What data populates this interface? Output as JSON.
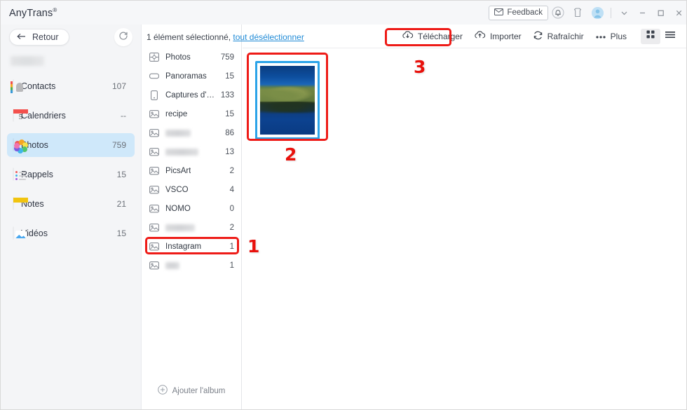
{
  "titlebar": {
    "app_name": "AnyTrans",
    "trademark": "®",
    "feedback_label": "Feedback",
    "icons": [
      "bell-icon",
      "gift-shirt-icon",
      "avatar-icon"
    ],
    "window_controls": [
      "chevron-down-icon",
      "minimize-icon",
      "maximize-icon",
      "close-icon"
    ]
  },
  "sidebar": {
    "back_label": "Retour",
    "sync_icon": "sync-icon",
    "device_name_redacted": "",
    "items": [
      {
        "label": "Contacts",
        "count": "107",
        "icon": "contacts-icon",
        "active": false
      },
      {
        "label": "Calendriers",
        "count": "--",
        "icon": "calendar-icon",
        "active": false
      },
      {
        "label": "Photos",
        "count": "759",
        "icon": "photos-icon",
        "active": true
      },
      {
        "label": "Rappels",
        "count": "15",
        "icon": "reminders-icon",
        "active": false
      },
      {
        "label": "Notes",
        "count": "21",
        "icon": "notes-icon",
        "active": false
      },
      {
        "label": "Vidéos",
        "count": "15",
        "icon": "videos-icon",
        "active": false
      }
    ]
  },
  "albums": {
    "items": [
      {
        "label": "Photos",
        "count": "759",
        "icon": "photos-grid-icon",
        "redacted": false,
        "selected": false
      },
      {
        "label": "Panoramas",
        "count": "15",
        "icon": "panorama-icon",
        "redacted": false,
        "selected": false
      },
      {
        "label": "Captures d'…",
        "count": "133",
        "icon": "screenshot-icon",
        "redacted": false,
        "selected": false
      },
      {
        "label": "recipe",
        "count": "15",
        "icon": "album-icon",
        "redacted": false,
        "selected": false
      },
      {
        "label": "",
        "count": "86",
        "icon": "album-icon",
        "redacted": true,
        "selected": false
      },
      {
        "label": "",
        "count": "13",
        "icon": "album-icon",
        "redacted": true,
        "selected": false
      },
      {
        "label": "PicsArt",
        "count": "2",
        "icon": "album-icon",
        "redacted": false,
        "selected": false
      },
      {
        "label": "VSCO",
        "count": "4",
        "icon": "album-icon",
        "redacted": false,
        "selected": false
      },
      {
        "label": "NOMO",
        "count": "0",
        "icon": "album-icon",
        "redacted": false,
        "selected": false
      },
      {
        "label": "",
        "count": "2",
        "icon": "album-icon",
        "redacted": true,
        "selected": false
      },
      {
        "label": "Instagram",
        "count": "1",
        "icon": "album-icon",
        "redacted": false,
        "selected": true
      },
      {
        "label": "",
        "count": "1",
        "icon": "album-icon",
        "redacted": true,
        "selected": false
      }
    ],
    "add_album_label": "Ajouter l'album"
  },
  "content": {
    "selection_prefix": "1 élément sélectionné,",
    "deselect_link": "tout désélectionner",
    "toolbar": {
      "download_label": "Télécharger",
      "import_label": "Importer",
      "refresh_label": "Rafraîchir",
      "more_label": "Plus",
      "grid_view_icon": "grid-view-icon",
      "list_view_icon": "list-view-icon"
    },
    "photos": [
      {
        "alt": "lake-landscape-thumbnail",
        "selected": true
      }
    ]
  },
  "annotations": [
    {
      "number": "1",
      "target": "album-instagram"
    },
    {
      "number": "2",
      "target": "photo-thumbnail"
    },
    {
      "number": "3",
      "target": "download-button"
    }
  ],
  "colors": {
    "accent": "#2ba3e8",
    "annotation_red": "#ee1b17",
    "link_blue": "#1f8ad6",
    "sidebar_bg": "#f4f5f7",
    "active_nav": "#cfe8fa"
  }
}
